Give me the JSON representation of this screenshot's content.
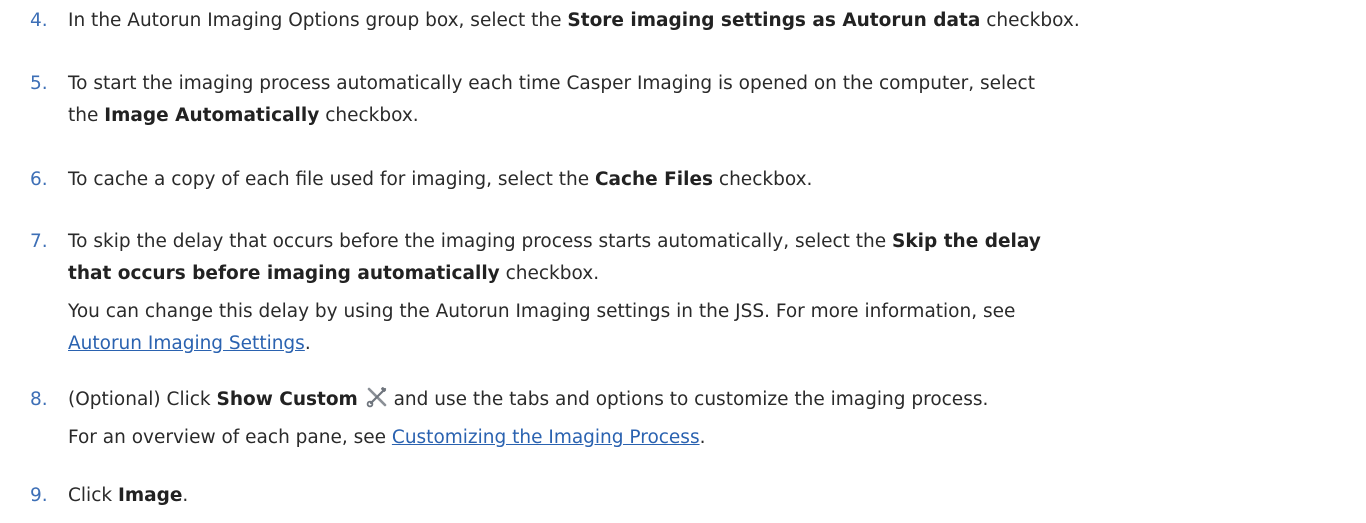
{
  "accent_color": "#3d6fb6",
  "link_color": "#2a62b0",
  "steps": [
    {
      "number": "4.",
      "t1": "In the Autorun Imaging Options group box, select the ",
      "b1": "Store imaging settings as Autorun data",
      "t2": " checkbox."
    },
    {
      "number": "5.",
      "t1": "To start the imaging process automatically each time Casper Imaging is opened on the computer, select",
      "t2": "the ",
      "b1": "Image Automatically",
      "t3": " checkbox."
    },
    {
      "number": "6.",
      "t1": "To cache a copy of each file used for imaging, select the ",
      "b1": "Cache Files",
      "t2": " checkbox."
    },
    {
      "number": "7.",
      "t1": "To skip the delay that occurs before the imaging process starts automatically, select the ",
      "b1": "Skip the delay",
      "b2": "that occurs before imaging automatically",
      "t2": " checkbox.",
      "note1": "You can change this delay by using the Autorun Imaging settings in the JSS. For more information, see",
      "link": "Autorun Imaging Settings",
      "note2": "."
    },
    {
      "number": "8.",
      "t1": "(Optional) Click ",
      "b1": "Show Custom",
      "icon": "tools-icon",
      "t2": " and use the tabs and options to customize the imaging process.",
      "note1": "For an overview of each pane, see ",
      "link": "Customizing the Imaging Process",
      "note2": "."
    },
    {
      "number": "9.",
      "t1": "Click ",
      "b1": "Image",
      "t2": "."
    }
  ]
}
